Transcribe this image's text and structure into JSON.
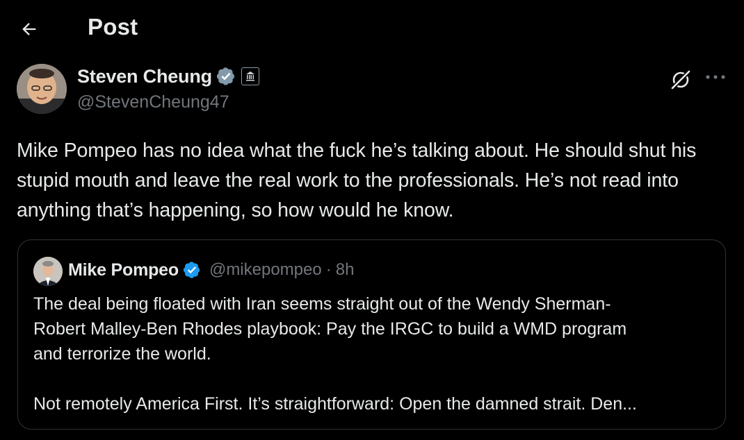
{
  "header": {
    "title": "Post",
    "back_icon": "arrow-left-icon"
  },
  "post": {
    "author_name": "Steven Cheung",
    "author_handle": "@StevenCheung47",
    "verified_color": "#829aab",
    "affiliation_icon": "white-house-seal-icon",
    "text": "Mike Pompeo has no idea what the fuck he’s talking about. He should shut his stupid mouth and leave the real work to the professionals. He’s not read into anything that’s happening, so how would he know."
  },
  "quoted_post": {
    "author_name": "Mike Pompeo",
    "author_handle": "@mikepompeo",
    "separator": "·",
    "time": "8h",
    "verified_color": "#1d9bf0",
    "text": "The deal being floated with Iran seems straight out of the Wendy Sherman-\nRobert Malley-Ben Rhodes playbook: Pay the IRGC to build a WMD program\nand terrorize the world.\n\nNot remotely America First. It’s straightforward: Open the damned strait. Den..."
  },
  "colors": {
    "background": "#000000",
    "primary_text": "#e7e9ea",
    "secondary_text": "#71767b",
    "border": "#2f3336"
  }
}
